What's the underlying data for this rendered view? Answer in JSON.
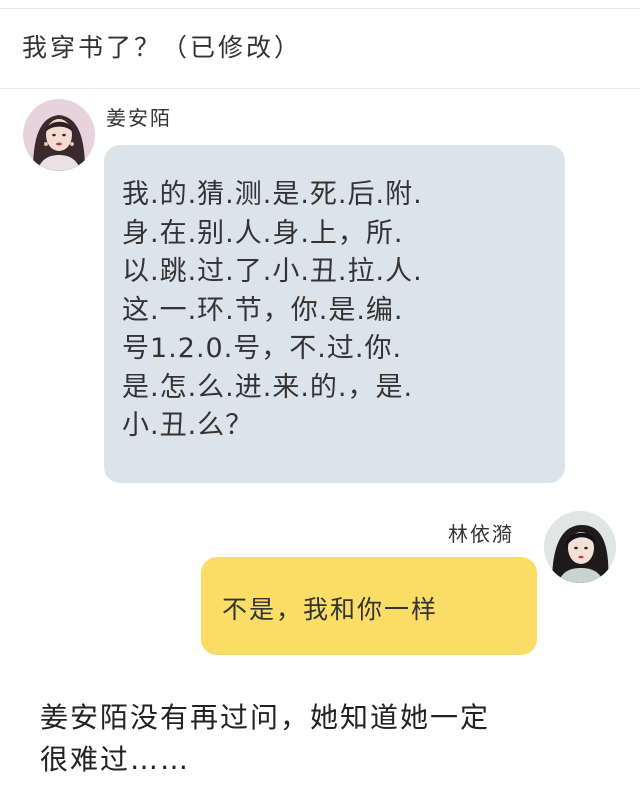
{
  "header": {
    "title": "我穿书了？（已修改）"
  },
  "messages": [
    {
      "sender": "姜安陌",
      "avatar_icon": "female-avatar-photo-icon",
      "side": "left",
      "bubble_color": "#dbe4ea",
      "lines": [
        "我.的.猜.测.是.死.后.附.",
        "身.在.别.人.身.上，所.",
        "以.跳.过.了.小.丑.拉.人.",
        "这.一.环.节，你.是.编.",
        "号1.2.0.号，不.过.你.",
        "是.怎.么.进.来.的.，是.",
        "小.丑.么？"
      ]
    },
    {
      "sender": "林依漪",
      "avatar_icon": "female-avatar-photo-icon",
      "side": "right",
      "bubble_color": "#fadd66",
      "text": "不是，我和你一样"
    }
  ],
  "narration": {
    "lines": [
      "姜安陌没有再过问，她知道她一定",
      "很难过……"
    ]
  }
}
